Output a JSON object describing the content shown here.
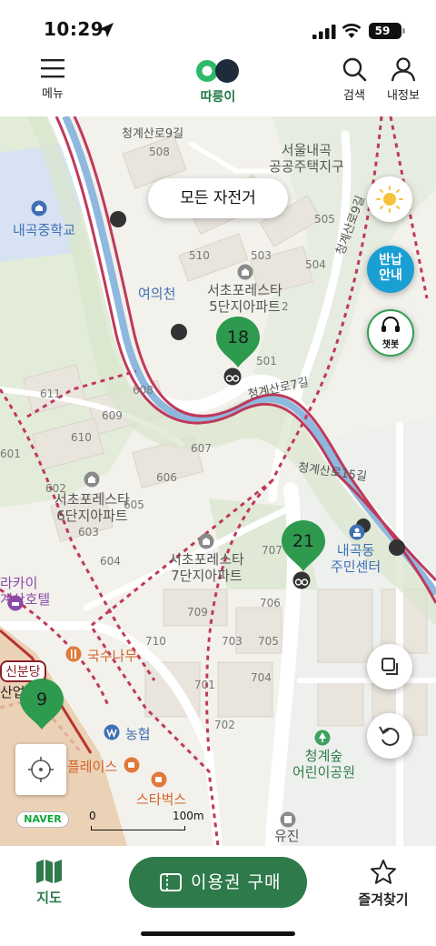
{
  "status_bar": {
    "time": "10:29",
    "battery": "59"
  },
  "header": {
    "menu_label": "메뉴",
    "logo_label": "따릉이",
    "search_label": "검색",
    "profile_label": "내정보"
  },
  "map": {
    "filter_label": "모든 자전거",
    "guide_label_line1": "반납",
    "guide_label_line2": "안내",
    "chatbot_label": "챗봇",
    "stations": [
      {
        "count": "18"
      },
      {
        "count": "21"
      },
      {
        "count": "9"
      }
    ],
    "labels": {
      "road1": "청계산로9길",
      "district1": "서울내곡",
      "district2": "공공주택지구",
      "school": "내곡중학교",
      "stream": "여의천",
      "apt5_1": "서초포레스타",
      "apt5_2": "5단지아파트",
      "apt6_1": "서초포레스타",
      "apt6_2": "6단지아파트",
      "apt7_1": "서초포레스타",
      "apt7_2": "7단지아파트",
      "road2": "청계산로7길",
      "road3": "청계산로15길",
      "road4": "청계산로9길",
      "community1": "내곡동",
      "community2": "주민센터",
      "hotel1": "라카이",
      "hotel2": "계산호텔",
      "restaurant": "국수나무",
      "bank": "농협",
      "place": "플레이스",
      "starbucks": "스타벅스",
      "daycare1": "청계숲",
      "daycare2": "어린이공원",
      "yujin": "유진",
      "station_partial": "신분당",
      "sanop": "산업",
      "b508": "508",
      "b505": "505",
      "b510": "510",
      "b503": "503",
      "b504": "504",
      "b502": "2",
      "b501": "501",
      "b611": "611",
      "b608": "608",
      "b609": "609",
      "b610": "610",
      "b607": "607",
      "b601": "601",
      "b602": "602",
      "b606": "606",
      "b605": "605",
      "b603": "603",
      "b604": "604",
      "b707": "707",
      "b706": "706",
      "b709": "709",
      "b710": "710",
      "b703": "703",
      "b705": "705",
      "b701": "701",
      "b704": "704",
      "b702": "702"
    },
    "naver_label": "NAVER",
    "scale_zero": "0",
    "scale_label": "100m"
  },
  "bottom_nav": {
    "map_label": "지도",
    "buy_label": "이용권 구매",
    "favorites_label": "즐겨찾기"
  },
  "colors": {
    "brand_green": "#2e7a4b",
    "pin_green": "#2e9a4e",
    "guide_blue": "#1a9fd3",
    "bike_path": "#c0395a"
  }
}
